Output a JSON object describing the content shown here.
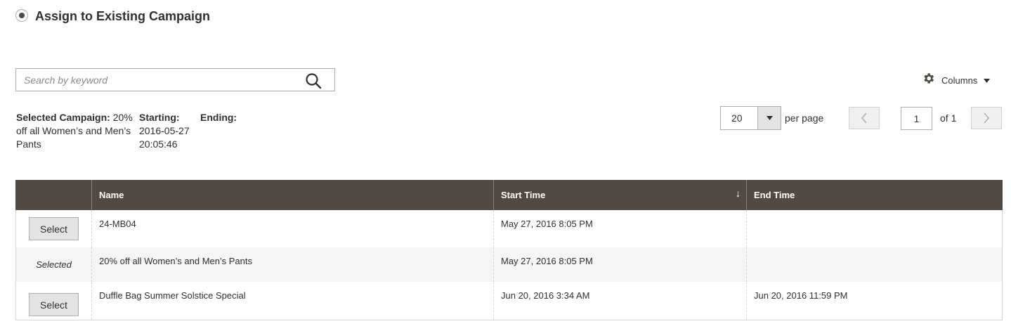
{
  "section": {
    "title": "Assign to Existing Campaign"
  },
  "search": {
    "placeholder": "Search by keyword"
  },
  "columns": {
    "label": "Columns"
  },
  "campaign_info": {
    "selected_label": "Selected Campaign:",
    "selected_value": "20% off all Women’s and Men’s Pants",
    "starting_label": "Starting:",
    "starting_value": "2016-05-27 20:05:46",
    "ending_label": "Ending:",
    "ending_value": ""
  },
  "pager": {
    "per_page": "20",
    "per_page_label": "per page",
    "current_page": "1",
    "of_label": "of 1"
  },
  "grid": {
    "headers": {
      "action": "",
      "name": "Name",
      "start_time": "Start Time",
      "end_time": "End Time"
    },
    "sort_indicator": "↓",
    "rows": [
      {
        "action": "Select",
        "name": "24-MB04",
        "start_time": "May 27, 2016 8:05 PM",
        "end_time": ""
      },
      {
        "action": "Selected",
        "name": "20% off all Women’s and Men’s Pants",
        "start_time": "May 27, 2016 8:05 PM",
        "end_time": ""
      },
      {
        "action": "Select",
        "name": "Duffle Bag Summer Solstice Special",
        "start_time": "Jun 20, 2016 3:34 AM",
        "end_time": "Jun 20, 2016 11:59 PM"
      }
    ]
  },
  "colors": {
    "header_bg": "#514943",
    "alt_row_bg": "#f5f5f5",
    "button_bg": "#e3e3e3"
  }
}
